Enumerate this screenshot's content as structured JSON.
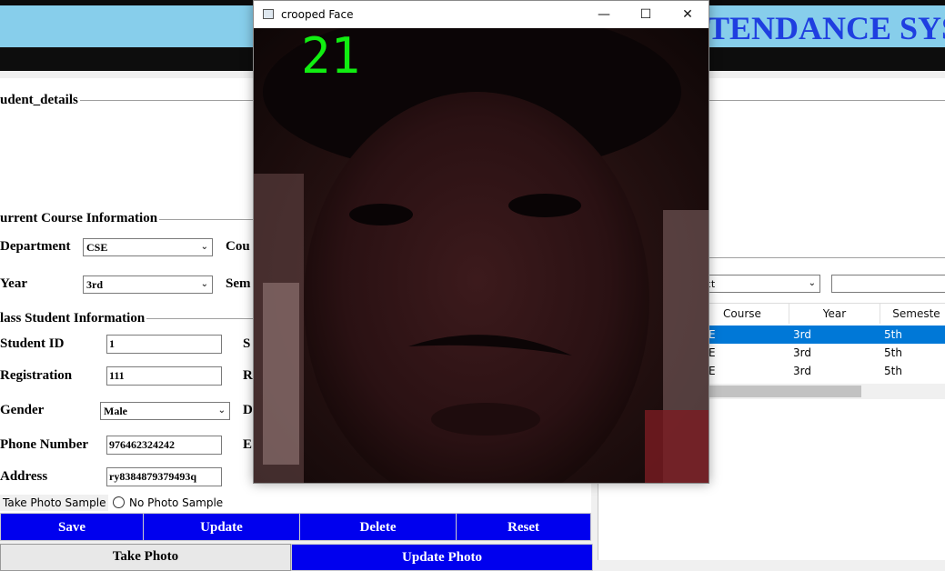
{
  "app": {
    "title_visible": "TENDANCE SYS"
  },
  "student_details": {
    "frame_label": "udent_details",
    "course_frame_label": "urrent Course Information",
    "department_label": "Department",
    "department_value": "CSE",
    "course_label_partial": "Cou",
    "year_label": "Year",
    "year_value": "3rd",
    "semester_label_partial": "Sem",
    "class_frame_label": "lass Student Information",
    "student_id_label": "Student ID",
    "student_id_value": "1",
    "student_name_label_partial": "S",
    "registration_label": "Registration",
    "registration_value": "111",
    "roll_label_partial": "R",
    "gender_label": "Gender",
    "gender_value": "Male",
    "dob_label_partial": "D",
    "phone_label": "Phone Number",
    "phone_value": "976462324242",
    "email_label_partial": "E",
    "address_label": "Address",
    "address_value": "ry8384879379493q",
    "radio_take_photo": "Take Photo Sample",
    "radio_no_photo": "No Photo Sample",
    "buttons": {
      "save": "Save",
      "update": "Update",
      "delete": "Delete",
      "reset": "Reset"
    },
    "take_photo_btn": "Take Photo",
    "update_photo_btn": "Update Photo"
  },
  "search": {
    "select_value": "ect"
  },
  "table": {
    "headers": [
      "Course",
      "Year",
      "Semeste"
    ],
    "rows": [
      {
        "dept": "E",
        "year": "3rd",
        "sem": "5th",
        "selected": true
      },
      {
        "dept": "E",
        "year": "3rd",
        "sem": "5th",
        "selected": false
      },
      {
        "dept": "E",
        "year": "3rd",
        "sem": "5th",
        "selected": false
      }
    ]
  },
  "popup": {
    "title": "crooped Face",
    "counter": "21",
    "minimize": "—",
    "maximize": "☐",
    "close": "✕"
  },
  "colors": {
    "header_bg": "#87CEEB",
    "title_blue": "#1f3fe0",
    "button_blue": "#0000ee",
    "selection": "#0078d7",
    "counter_green": "#11ee11"
  }
}
